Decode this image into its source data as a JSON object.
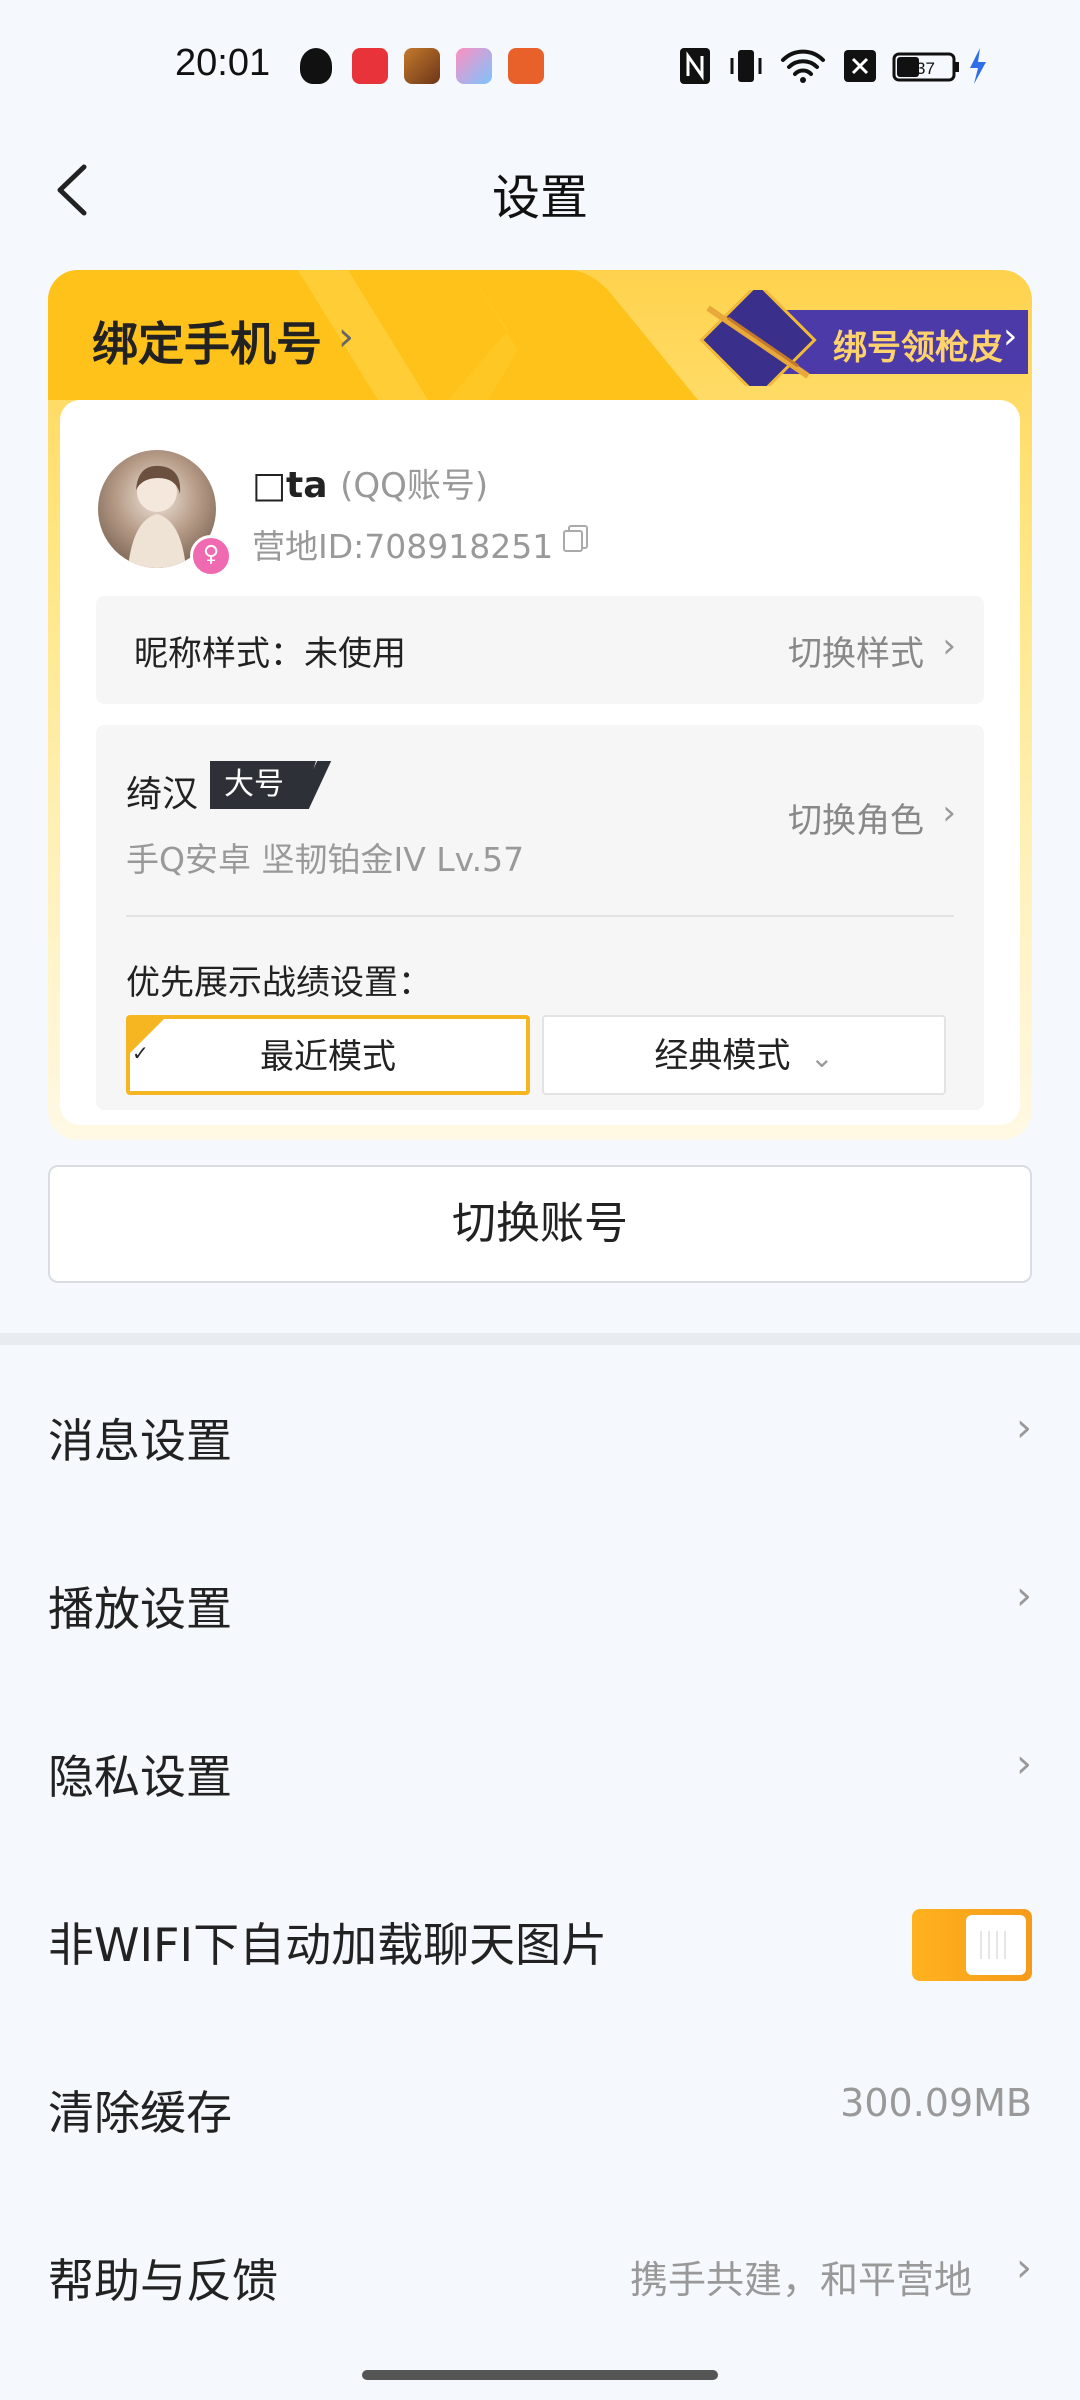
{
  "status_bar": {
    "time": "20:01",
    "battery": "37",
    "app_icons": [
      "shield-icon",
      "music-icon",
      "game-avatar-icon",
      "puzzle-icon",
      "cf-game-icon"
    ],
    "right_icons": [
      "nfc-icon",
      "vibrate-icon",
      "wifi-icon",
      "close-box-icon",
      "battery-icon",
      "charging-icon"
    ]
  },
  "header": {
    "title": "设置"
  },
  "account_card": {
    "bind_phone": "绑定手机号",
    "promo": "绑号领枪皮",
    "user": {
      "name": "□ta",
      "account_type": "(QQ账号)",
      "camp_id": "营地ID:708918251"
    },
    "nickname_style": {
      "label": "昵称样式：未使用",
      "action": "切换样式"
    },
    "role": {
      "name": "绮汉",
      "tag": "大号",
      "detail": "手Q安卓  坚韧铂金IV  Lv.57",
      "action": "切换角色"
    },
    "record_pref": {
      "label": "优先展示战绩设置：",
      "modes": [
        "最近模式",
        "经典模式"
      ],
      "selected": "最近模式"
    }
  },
  "switch_account": "切换账号",
  "settings": {
    "message": "消息设置",
    "playback": "播放设置",
    "privacy": "隐私设置",
    "auto_load_images": {
      "label": "非WIFI下自动加载聊天图片",
      "enabled": true
    },
    "clear_cache": {
      "label": "清除缓存",
      "value": "300.09MB"
    },
    "help": {
      "label": "帮助与反馈",
      "value": "携手共建，和平营地"
    }
  },
  "colors": {
    "accent": "#f5b622",
    "toggle": "#ffb21e",
    "background": "#f5f8fc"
  }
}
